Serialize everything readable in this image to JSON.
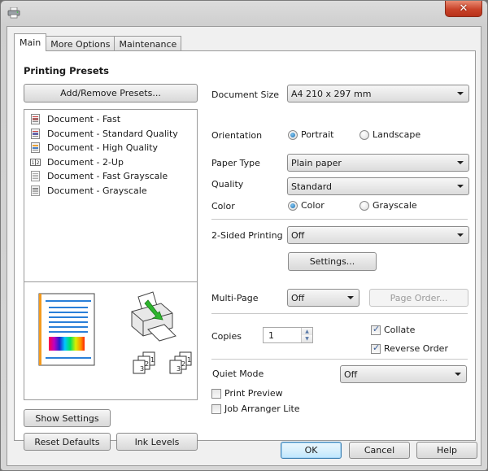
{
  "window": {
    "app_icon": "printer-icon",
    "close_label": "✕"
  },
  "tabs": [
    {
      "label": "Main",
      "active": true
    },
    {
      "label": "More Options",
      "active": false
    },
    {
      "label": "Maintenance",
      "active": false
    }
  ],
  "presets": {
    "title": "Printing Presets",
    "add_remove_label": "Add/Remove Presets...",
    "items": [
      {
        "label": "Document - Fast",
        "icon": "document-color-icon"
      },
      {
        "label": "Document - Standard Quality",
        "icon": "document-color-icon"
      },
      {
        "label": "Document - High Quality",
        "icon": "document-high-quality-icon"
      },
      {
        "label": "Document - 2-Up",
        "icon": "two-up-icon"
      },
      {
        "label": "Document - Fast Grayscale",
        "icon": "document-gray-icon"
      },
      {
        "label": "Document - Grayscale",
        "icon": "document-grayscale-icon"
      }
    ]
  },
  "preview": {
    "page_icon": "page-preview-icon",
    "printer_icon": "printer-feed-icon",
    "collate_icons": [
      "collate-stack-icon",
      "collate-stack-icon"
    ]
  },
  "left_buttons": {
    "show_settings": "Show Settings",
    "reset_defaults": "Reset Defaults",
    "ink_levels": "Ink Levels"
  },
  "settings": {
    "document_size": {
      "label": "Document Size",
      "value": "A4 210 x 297 mm"
    },
    "orientation": {
      "label": "Orientation",
      "options": [
        "Portrait",
        "Landscape"
      ],
      "selected": "Portrait"
    },
    "paper_type": {
      "label": "Paper Type",
      "value": "Plain paper"
    },
    "quality": {
      "label": "Quality",
      "value": "Standard"
    },
    "color": {
      "label": "Color",
      "options": [
        "Color",
        "Grayscale"
      ],
      "selected": "Color"
    },
    "two_sided": {
      "label": "2-Sided Printing",
      "value": "Off",
      "settings_label": "Settings..."
    },
    "multi_page": {
      "label": "Multi-Page",
      "value": "Off",
      "page_order_label": "Page Order..."
    },
    "copies": {
      "label": "Copies",
      "value": "1"
    },
    "collate": {
      "label": "Collate",
      "checked": true
    },
    "reverse_order": {
      "label": "Reverse Order",
      "checked": true
    },
    "quiet_mode": {
      "label": "Quiet Mode",
      "value": "Off"
    },
    "print_preview": {
      "label": "Print Preview",
      "checked": false
    },
    "job_arranger": {
      "label": "Job Arranger Lite",
      "checked": false
    }
  },
  "footer": {
    "ok": "OK",
    "cancel": "Cancel",
    "help": "Help"
  }
}
